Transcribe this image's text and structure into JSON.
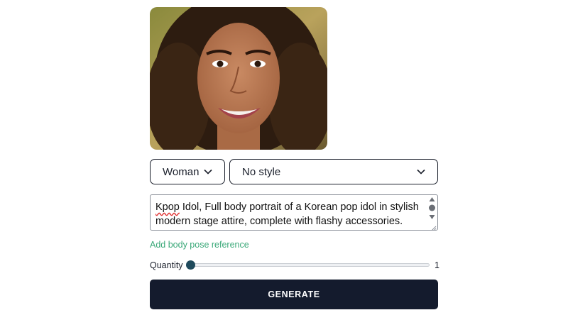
{
  "preview": {
    "image": "portrait-photo",
    "bg_colors": [
      "#6e6a2a",
      "#b29a52",
      "#3a2a18"
    ]
  },
  "gender_select": {
    "value": "Woman",
    "icon": "chevron-down-icon"
  },
  "style_select": {
    "value": "No style",
    "icon": "chevron-down-icon"
  },
  "prompt": {
    "value_first_word": "Kpop",
    "value_rest": " Idol, Full body portrait of a Korean pop idol in stylish modern stage attire, complete with flashy accessories."
  },
  "pose_link": "Add body pose reference",
  "quantity": {
    "label": "Quantity",
    "value": "1",
    "level": 0
  },
  "generate_button": "GENERATE",
  "colors": {
    "accent_green": "#3aa878",
    "button_bg": "#141b2d",
    "thumb": "#1f4a5c"
  }
}
